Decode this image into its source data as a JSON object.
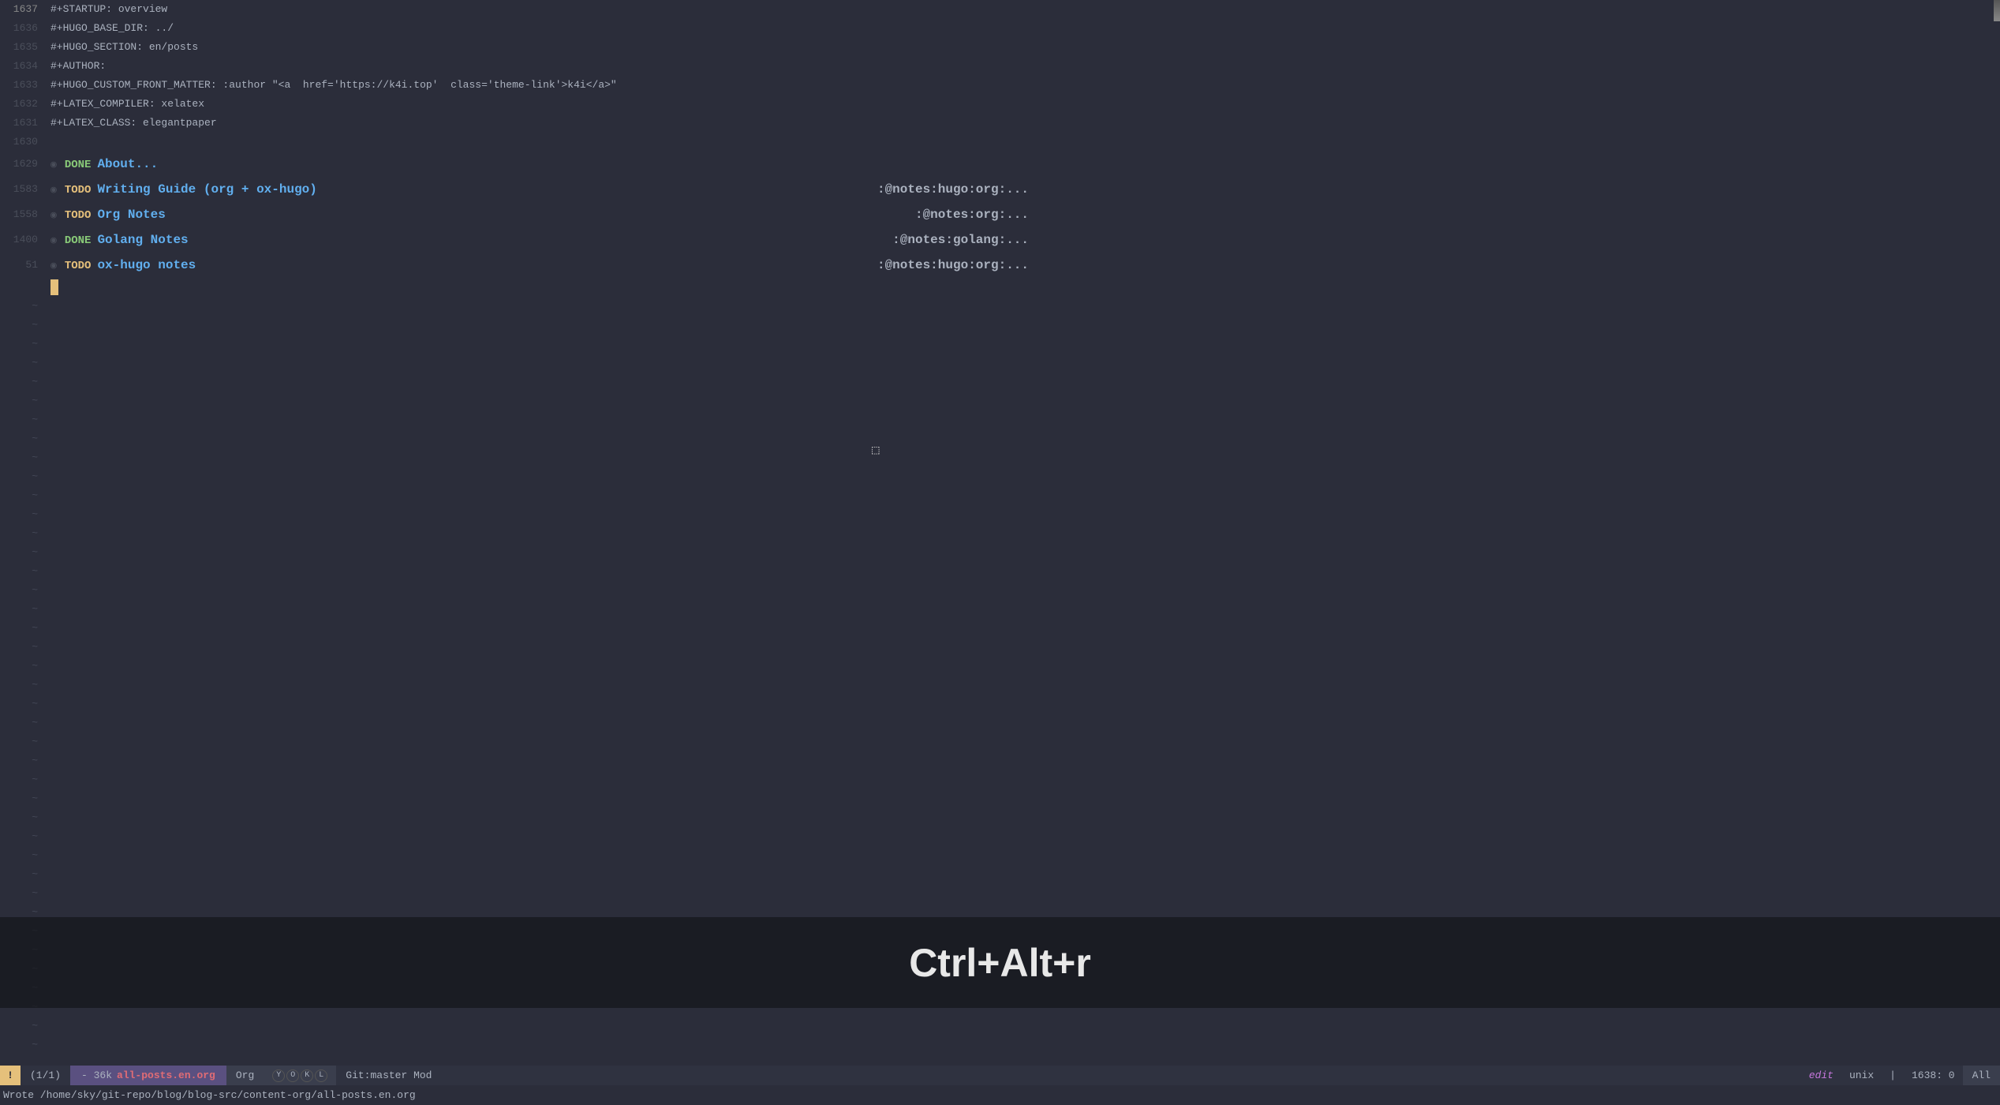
{
  "header_lines": [
    {
      "ln": "1637",
      "text": "#+STARTUP: overview"
    },
    {
      "ln": "1636",
      "text": "#+HUGO_BASE_DIR: ../"
    },
    {
      "ln": "1635",
      "text": "#+HUGO_SECTION: en/posts"
    },
    {
      "ln": "1634",
      "text": "#+AUTHOR:"
    },
    {
      "ln": "1633",
      "text": "#+HUGO_CUSTOM_FRONT_MATTER: :author \"<a  href='https://k4i.top'  class='theme-link'>k4i</a>\""
    },
    {
      "ln": "1632",
      "text": "#+LATEX_COMPILER: xelatex"
    },
    {
      "ln": "1631",
      "text": "#+LATEX_CLASS: elegantpaper"
    },
    {
      "ln": "1630",
      "text": ""
    }
  ],
  "outlines": [
    {
      "ln": "1629",
      "state": "DONE",
      "title": "About...",
      "tags": ""
    },
    {
      "ln": "1583",
      "state": "TODO",
      "title": "Writing Guide (org + ox-hugo)",
      "tags": ":@notes:hugo:org:..."
    },
    {
      "ln": "1558",
      "state": "TODO",
      "title": "Org Notes",
      "tags": ":@notes:org:..."
    },
    {
      "ln": "1400",
      "state": "DONE",
      "title": "Golang Notes",
      "tags": ":@notes:golang:..."
    },
    {
      "ln": "51",
      "state": "TODO",
      "title": "ox-hugo notes",
      "tags": ":@notes:hugo:org:..."
    }
  ],
  "screencast": "Ctrl+Alt+r",
  "status": {
    "warn_icon": "!",
    "position": "(1/1)",
    "size": "- 36k",
    "filename": "all-posts.en.org",
    "mode": "Org",
    "whichkey": "Y O K L",
    "vcs": "Git:master Mod",
    "edit": "edit",
    "encoding": "unix",
    "sep1": "|",
    "lineinfo": "1638: 0",
    "scroll": "All"
  },
  "echo": "Wrote /home/sky/git-repo/blog/blog-src/content-org/all-posts.en.org"
}
